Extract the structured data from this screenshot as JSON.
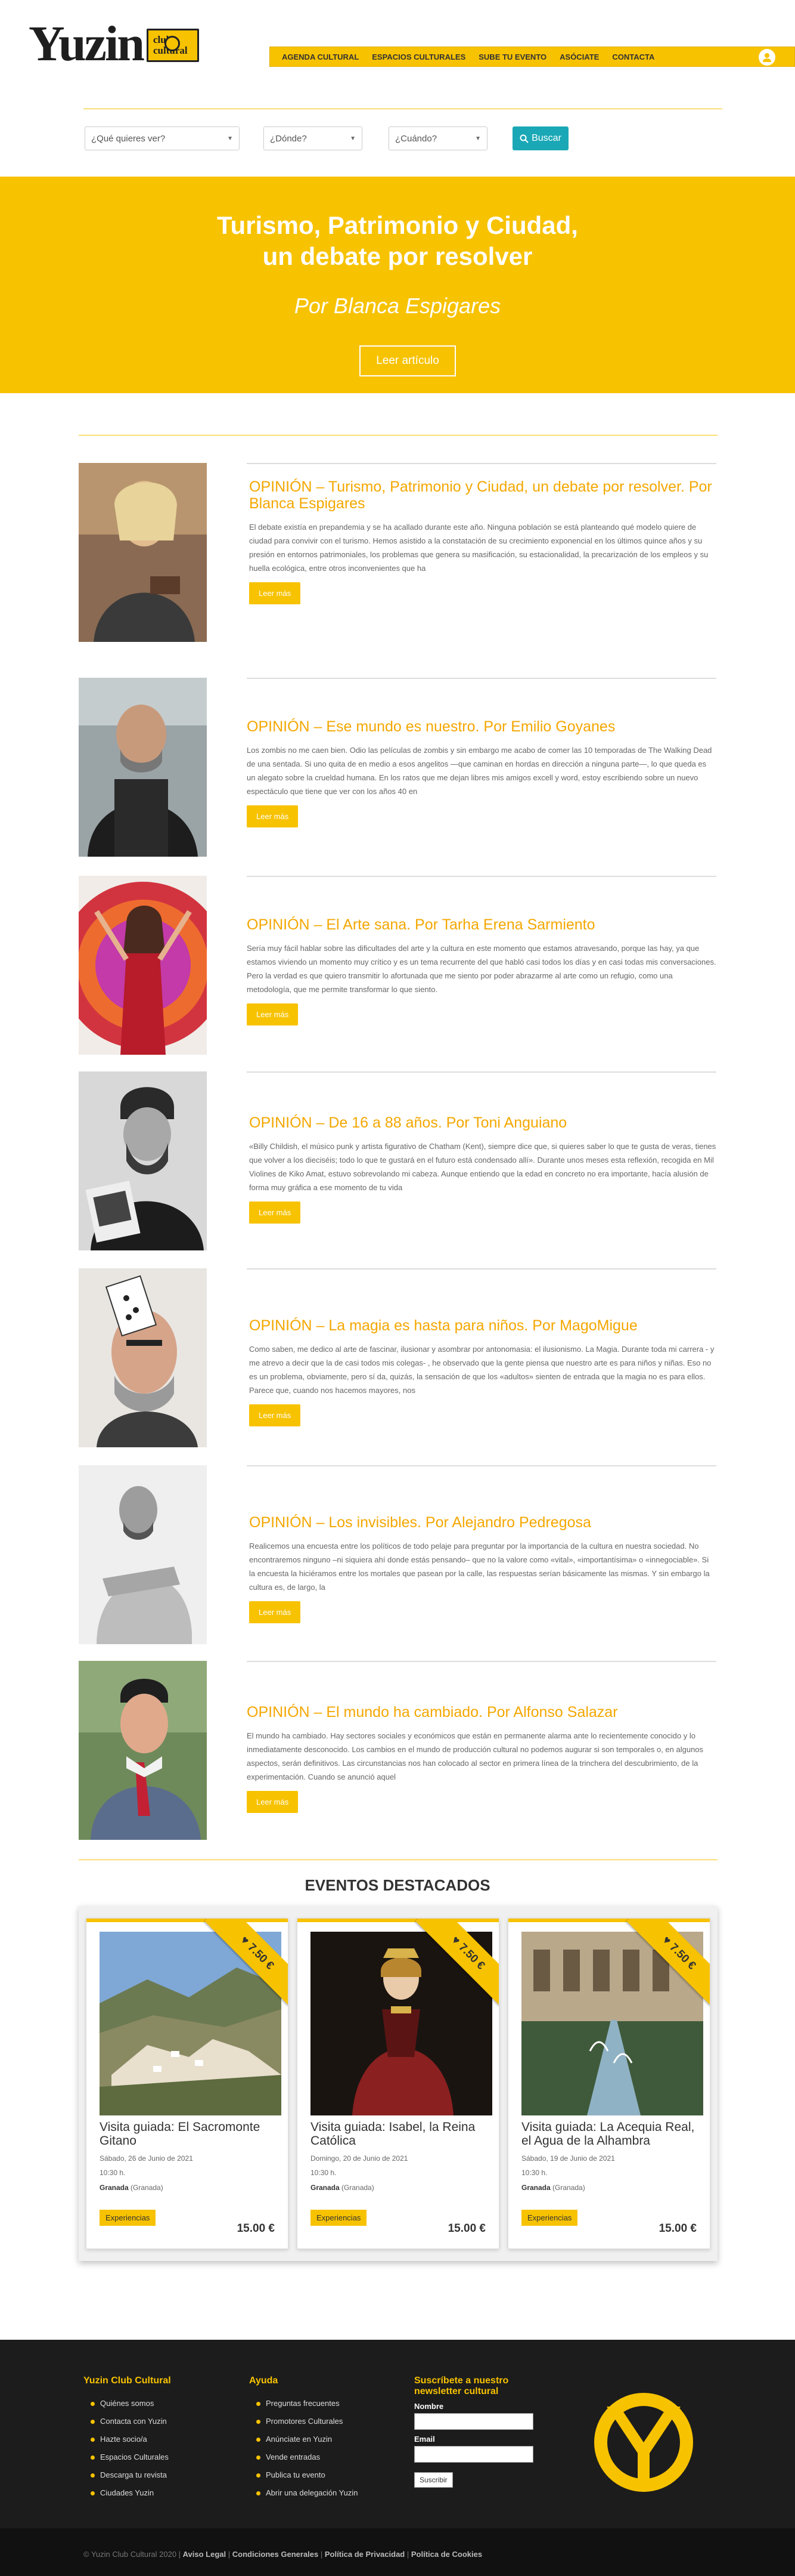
{
  "header": {
    "logo_word": "Yuzin",
    "logo_badge_line1": "club",
    "logo_badge_line2": "cultural",
    "nav": [
      "AGENDA CULTURAL",
      "ESPACIOS CULTURALES",
      "SUBE TU EVENTO",
      "ASÓCIATE",
      "CONTACTA"
    ]
  },
  "search": {
    "what": "¿Qué quieres ver?",
    "where": "¿Dónde?",
    "when": "¿Cuándo?",
    "button": "Buscar"
  },
  "hero": {
    "title_line1": "Turismo, Patrimonio y Ciudad,",
    "title_line2": "un debate por resolver",
    "subtitle": "Por Blanca Espigares",
    "button": "Leer artículo"
  },
  "articles": [
    {
      "title": "OPINIÓN – Turismo, Patrimonio y Ciudad, un debate por resolver. Por Blanca Espigares",
      "excerpt": "El debate existía en prepandemia y se ha acallado durante este año. Ninguna población se está planteando qué modelo quiere de ciudad para convivir con el turismo. Hemos asistido a la constatación de su crecimiento exponencial en los últimos quince años y su presión en entornos patrimoniales, los problemas que genera su masificación, su estacionalidad, la precarización de los empleos y su huella ecológica, entre otros inconvenientes que ha",
      "more": "Leer más"
    },
    {
      "title": "OPINIÓN – Ese mundo es nuestro. Por Emilio Goyanes",
      "excerpt": "Los zombis no me caen bien. Odio las películas de zombis y sin embargo me acabo de comer las 10 temporadas de The Walking Dead de una sentada. Si uno quita de en medio a esos angelitos —que caminan en hordas en dirección a ninguna parte—, lo que queda es un alegato sobre la crueldad humana. En los ratos que me dejan libres mis amigos excell y word, estoy escribiendo sobre un nuevo espectáculo que tiene que ver con los años 40 en",
      "more": "Leer más"
    },
    {
      "title": "OPINIÓN – El Arte sana. Por Tarha Erena Sarmiento",
      "excerpt": "Sería muy fácil hablar sobre las dificultades del arte y la cultura en este momento que estamos atravesando, porque las hay, ya que estamos viviendo un momento muy crítico y es un tema recurrente del que habló casi todos los días y en casi todas mis conversaciones. Pero la verdad es que quiero transmitir lo afortunada que me siento por poder abrazarme al arte como un refugio, como una metodología, que me permite transformar lo que siento.",
      "more": "Leer más"
    },
    {
      "title": "OPINIÓN – De 16 a 88 años. Por Toni Anguiano",
      "excerpt": "«Billy Childish, el músico punk y artista figurativo de Chatham (Kent), siempre dice que, si quieres saber lo que te gusta de veras, tienes que volver a los dieciséis; todo lo que te gustará en el futuro está condensado allí». Durante unos meses esta reflexión, recogida en Mil Violines de Kiko Amat, estuvo sobrevolando mi cabeza. Aunque entiendo que la edad en concreto no era importante, hacía alusión de forma muy gráfica a ese momento de tu vida",
      "more": "Leer más"
    },
    {
      "title": "OPINIÓN – La magia es hasta para niños. Por MagoMigue",
      "excerpt": "Como saben, me dedico al arte de fascinar, ilusionar y asombrar por antonomasia: el ilusionismo. La Magia. Durante toda mi carrera - y me atrevo a decir que la de casi todos mis colegas- , he observado que la gente piensa que nuestro arte es para niños y niñas. Eso no es un problema, obviamente, pero sí da, quizás, la sensación de que los «adultos» sienten de entrada que la magia no es para ellos. Parece que, cuando nos hacemos mayores, nos",
      "more": "Leer más"
    },
    {
      "title": "OPINIÓN – Los invisibles. Por Alejandro Pedregosa",
      "excerpt": "Realicemos una encuesta entre los políticos de todo pelaje para preguntar por la importancia de la cultura en nuestra sociedad. No encontraremos ninguno –ni siquiera ahí donde estás pensando– que no la valore como «vital», «importantísima» o «innegociable». Si la encuesta la hiciéramos entre los mortales que pasean por la calle, las respuestas serían básicamente las mismas. Y sin embargo la cultura es, de largo, la",
      "more": "Leer más"
    },
    {
      "title": "OPINIÓN –  El mundo ha cambiado. Por Alfonso Salazar",
      "excerpt": "El mundo ha cambiado. Hay sectores sociales y económicos que están en permanente alarma ante lo recientemente conocido y lo inmediatamente desconocido. Los cambios en el mundo de producción cultural no podemos augurar si son temporales o, en algunos aspectos, serán definitivos. Las circunstancias nos han colocado al sector en primera línea de la trinchera del descubrimiento, de la experimentación. Cuando se anunció aquel",
      "more": "Leer más"
    }
  ],
  "events": {
    "heading": "EVENTOS DESTACADOS",
    "items": [
      {
        "ribbon": "7.50 €",
        "title": "Visita guiada: El Sacromonte Gitano",
        "date": "Sábado, 26 de Junio de 2021",
        "time": "10:30 h.",
        "city": "Granada",
        "region": "(Granada)",
        "tag": "Experiencias",
        "price": "15.00 €"
      },
      {
        "ribbon": "7.50 €",
        "title": "Visita guiada: Isabel, la Reina Católica",
        "date": "Domingo, 20 de Junio de 2021",
        "time": "10:30 h.",
        "city": "Granada",
        "region": "(Granada)",
        "tag": "Experiencias",
        "price": "15.00 €"
      },
      {
        "ribbon": "7.50 €",
        "title": "Visita guiada: La Acequia Real, el Agua de la Alhambra",
        "date": "Sábado, 19 de Junio de 2021",
        "time": "10:30 h.",
        "city": "Granada",
        "region": "(Granada)",
        "tag": "Experiencias",
        "price": "15.00 €"
      }
    ]
  },
  "footer": {
    "col1_title": "Yuzin Club Cultural",
    "col1": [
      "Quiénes somos",
      "Contacta con Yuzin",
      "Hazte socio/a",
      "Espacios Culturales",
      "Descarga tu revista",
      "Ciudades Yuzin"
    ],
    "col2_title": "Ayuda",
    "col2": [
      "Preguntas frecuentes",
      "Promotores Culturales",
      "Anúnciate en Yuzin",
      "Vende entradas",
      "Publica tu evento",
      "Abrir una delegación Yuzin"
    ],
    "news_title": "Suscríbete a nuestro newsletter cultural",
    "name_label": "Nombre",
    "email_label": "Email",
    "submit": "Suscribir",
    "copyright": "© Yuzin Club Cultural 2020",
    "legal": [
      "Aviso Legal",
      "Condiciones Generales",
      "Política de Privacidad",
      "Política de Cookies"
    ]
  },
  "colors": {
    "accent": "#f7c200",
    "title": "#f4a700",
    "button": "#1aa8b6",
    "footer": "#1c1c1c"
  }
}
